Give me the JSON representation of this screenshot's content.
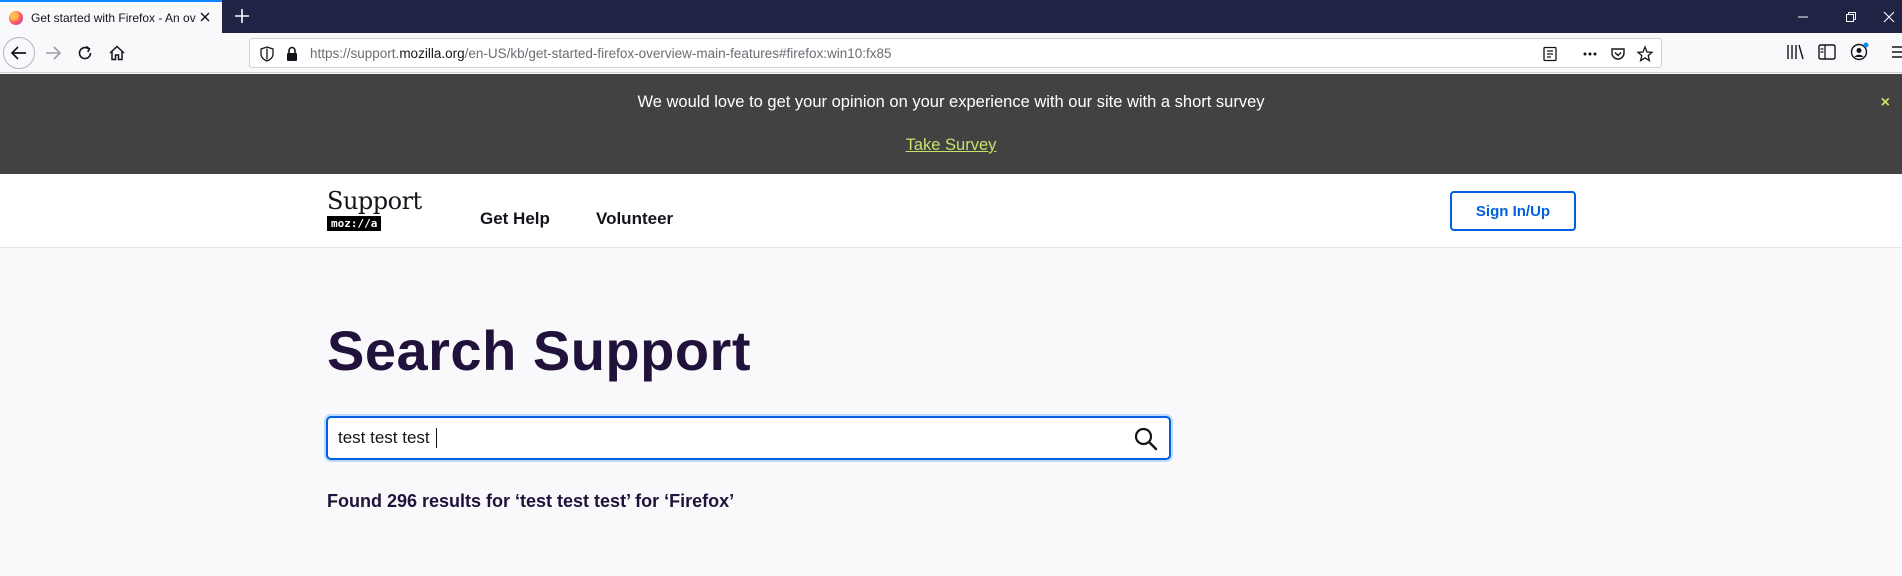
{
  "browser": {
    "tab_title": "Get started with Firefox - An ov",
    "url_prefix": "https://support.",
    "url_host": "mozilla.org",
    "url_path": "/en-US/kb/get-started-firefox-overview-main-features#firefox:win10:fx85"
  },
  "survey": {
    "message": "We would love to get your opinion on your experience with our site with a short survey",
    "link_label": "Take Survey",
    "close_label": "×"
  },
  "header": {
    "logo_word": "Support",
    "logo_sub": "moz://a",
    "nav": [
      "Get Help",
      "Volunteer"
    ],
    "signin_label": "Sign In/Up"
  },
  "main": {
    "title": "Search Support",
    "search_value": "test test test",
    "results_text": "Found 296 results for ‘test test test’ for ‘Firefox’"
  },
  "colors": {
    "titlebar": "#1f2344",
    "survey_bg": "#424242",
    "survey_link": "#c6e26a",
    "accent": "#0060df",
    "heading": "#20123a"
  }
}
